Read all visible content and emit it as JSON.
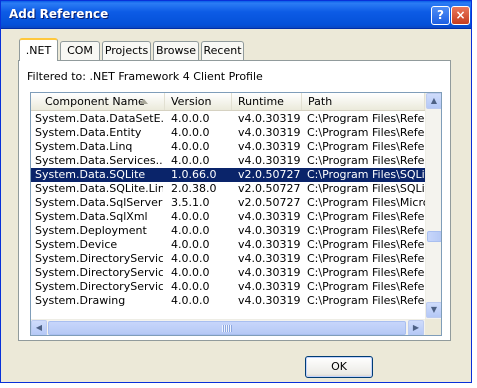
{
  "window": {
    "title": "Add Reference",
    "help_label": "?",
    "close_label": "×"
  },
  "tabs": [
    {
      "label": ".NET",
      "active": true
    },
    {
      "label": "COM",
      "active": false
    },
    {
      "label": "Projects",
      "active": false
    },
    {
      "label": "Browse",
      "active": false
    },
    {
      "label": "Recent",
      "active": false
    }
  ],
  "filter_text": "Filtered to: .NET Framework 4 Client Profile",
  "list": {
    "columns": [
      "Component Name",
      "Version",
      "Runtime",
      "Path"
    ],
    "sorted_column": "Component Name",
    "selected_index": 4,
    "rows": [
      {
        "name": "System.Data.DataSetE...",
        "version": "4.0.0.0",
        "runtime": "v4.0.30319",
        "path": "C:\\Program Files\\Refer..."
      },
      {
        "name": "System.Data.Entity",
        "version": "4.0.0.0",
        "runtime": "v4.0.30319",
        "path": "C:\\Program Files\\Refer..."
      },
      {
        "name": "System.Data.Linq",
        "version": "4.0.0.0",
        "runtime": "v4.0.30319",
        "path": "C:\\Program Files\\Refer..."
      },
      {
        "name": "System.Data.Services....",
        "version": "4.0.0.0",
        "runtime": "v4.0.30319",
        "path": "C:\\Program Files\\Refer..."
      },
      {
        "name": "System.Data.SQLite",
        "version": "1.0.66.0",
        "runtime": "v2.0.50727",
        "path": "C:\\Program Files\\SQLit..."
      },
      {
        "name": "System.Data.SQLite.Linq",
        "version": "2.0.38.0",
        "runtime": "v2.0.50727",
        "path": "C:\\Program Files\\SQLit..."
      },
      {
        "name": "System.Data.SqlServerCe",
        "version": "3.5.1.0",
        "runtime": "v2.0.50727",
        "path": "C:\\Program Files\\Micros..."
      },
      {
        "name": "System.Data.SqlXml",
        "version": "4.0.0.0",
        "runtime": "v4.0.30319",
        "path": "C:\\Program Files\\Refer..."
      },
      {
        "name": "System.Deployment",
        "version": "4.0.0.0",
        "runtime": "v4.0.30319",
        "path": "C:\\Program Files\\Refer..."
      },
      {
        "name": "System.Device",
        "version": "4.0.0.0",
        "runtime": "v4.0.30319",
        "path": "C:\\Program Files\\Refer..."
      },
      {
        "name": "System.DirectoryServices",
        "version": "4.0.0.0",
        "runtime": "v4.0.30319",
        "path": "C:\\Program Files\\Refer..."
      },
      {
        "name": "System.DirectoryServic...",
        "version": "4.0.0.0",
        "runtime": "v4.0.30319",
        "path": "C:\\Program Files\\Refer..."
      },
      {
        "name": "System.DirectoryServic...",
        "version": "4.0.0.0",
        "runtime": "v4.0.30319",
        "path": "C:\\Program Files\\Refer..."
      },
      {
        "name": "System.Drawing",
        "version": "4.0.0.0",
        "runtime": "v4.0.30319",
        "path": "C:\\Program Files\\Refer..."
      }
    ]
  },
  "buttons": {
    "ok_label": "OK"
  },
  "colors": {
    "title_bar": "#0a5ee8",
    "selection": "#0a246a",
    "dialog_bg": "#ece9d8"
  }
}
